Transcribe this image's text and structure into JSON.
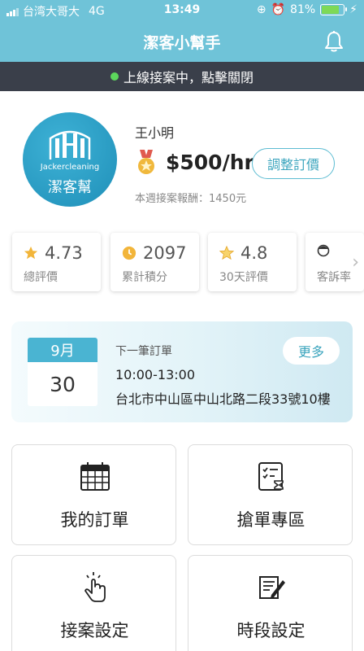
{
  "status_bar": {
    "carrier": "台湾大哥大",
    "network": "4G",
    "time": "13:49",
    "battery": "81%",
    "battery_level": 0.81
  },
  "nav": {
    "title": "潔客小幫手",
    "bell_icon": "bell-icon"
  },
  "online_banner": {
    "text": "上線接案中，點擊關閉",
    "dot_color": "#5cd65c"
  },
  "profile": {
    "logo_en": "Jackercleaning",
    "logo_zh": "潔客幫",
    "name": "王小明",
    "rate": "$500/hr",
    "adjust_button": "調整訂價",
    "weekly_earnings": "本週接案報酬：1450元"
  },
  "stats": [
    {
      "icon": "star-icon",
      "value": "4.73",
      "label": "總評價"
    },
    {
      "icon": "coin-icon",
      "value": "2097",
      "label": "累計積分"
    },
    {
      "icon": "star-outline-icon",
      "value": "4.8",
      "label": "30天評價"
    },
    {
      "icon": "face-icon",
      "value": "",
      "label": "客訴率"
    }
  ],
  "next_order": {
    "month": "9月",
    "day": "30",
    "label": "下一筆訂單",
    "more_button": "更多",
    "time": "10:00-13:00",
    "address": "台北市中山區中山北路二段33號10樓"
  },
  "menu": [
    {
      "icon": "calendar-icon",
      "label": "我的訂單"
    },
    {
      "icon": "checklist-icon",
      "label": "搶單專區"
    },
    {
      "icon": "tap-hand-icon",
      "label": "接案設定"
    },
    {
      "icon": "document-pen-icon",
      "label": "時段設定"
    }
  ],
  "colors": {
    "primary": "#6fc3d8",
    "accent": "#3aa4bd",
    "banner_bg": "#3a3f4a"
  }
}
